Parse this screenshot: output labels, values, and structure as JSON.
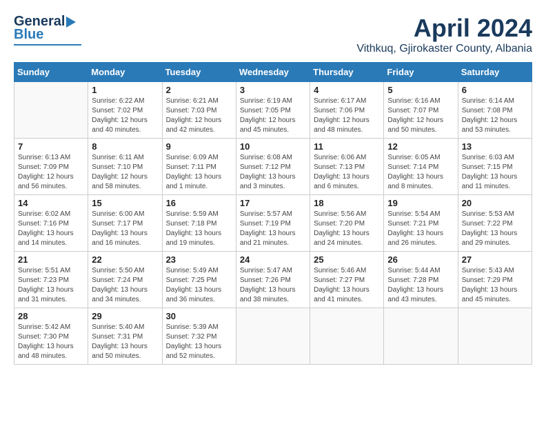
{
  "header": {
    "logo": {
      "line1": "General",
      "line2": "Blue"
    },
    "title": "April 2024",
    "subtitle": "Vithkuq, Gjirokaster County, Albania"
  },
  "weekdays": [
    "Sunday",
    "Monday",
    "Tuesday",
    "Wednesday",
    "Thursday",
    "Friday",
    "Saturday"
  ],
  "weeks": [
    [
      {
        "day": "",
        "sunrise": "",
        "sunset": "",
        "daylight": ""
      },
      {
        "day": "1",
        "sunrise": "Sunrise: 6:22 AM",
        "sunset": "Sunset: 7:02 PM",
        "daylight": "Daylight: 12 hours and 40 minutes."
      },
      {
        "day": "2",
        "sunrise": "Sunrise: 6:21 AM",
        "sunset": "Sunset: 7:03 PM",
        "daylight": "Daylight: 12 hours and 42 minutes."
      },
      {
        "day": "3",
        "sunrise": "Sunrise: 6:19 AM",
        "sunset": "Sunset: 7:05 PM",
        "daylight": "Daylight: 12 hours and 45 minutes."
      },
      {
        "day": "4",
        "sunrise": "Sunrise: 6:17 AM",
        "sunset": "Sunset: 7:06 PM",
        "daylight": "Daylight: 12 hours and 48 minutes."
      },
      {
        "day": "5",
        "sunrise": "Sunrise: 6:16 AM",
        "sunset": "Sunset: 7:07 PM",
        "daylight": "Daylight: 12 hours and 50 minutes."
      },
      {
        "day": "6",
        "sunrise": "Sunrise: 6:14 AM",
        "sunset": "Sunset: 7:08 PM",
        "daylight": "Daylight: 12 hours and 53 minutes."
      }
    ],
    [
      {
        "day": "7",
        "sunrise": "Sunrise: 6:13 AM",
        "sunset": "Sunset: 7:09 PM",
        "daylight": "Daylight: 12 hours and 56 minutes."
      },
      {
        "day": "8",
        "sunrise": "Sunrise: 6:11 AM",
        "sunset": "Sunset: 7:10 PM",
        "daylight": "Daylight: 12 hours and 58 minutes."
      },
      {
        "day": "9",
        "sunrise": "Sunrise: 6:09 AM",
        "sunset": "Sunset: 7:11 PM",
        "daylight": "Daylight: 13 hours and 1 minute."
      },
      {
        "day": "10",
        "sunrise": "Sunrise: 6:08 AM",
        "sunset": "Sunset: 7:12 PM",
        "daylight": "Daylight: 13 hours and 3 minutes."
      },
      {
        "day": "11",
        "sunrise": "Sunrise: 6:06 AM",
        "sunset": "Sunset: 7:13 PM",
        "daylight": "Daylight: 13 hours and 6 minutes."
      },
      {
        "day": "12",
        "sunrise": "Sunrise: 6:05 AM",
        "sunset": "Sunset: 7:14 PM",
        "daylight": "Daylight: 13 hours and 8 minutes."
      },
      {
        "day": "13",
        "sunrise": "Sunrise: 6:03 AM",
        "sunset": "Sunset: 7:15 PM",
        "daylight": "Daylight: 13 hours and 11 minutes."
      }
    ],
    [
      {
        "day": "14",
        "sunrise": "Sunrise: 6:02 AM",
        "sunset": "Sunset: 7:16 PM",
        "daylight": "Daylight: 13 hours and 14 minutes."
      },
      {
        "day": "15",
        "sunrise": "Sunrise: 6:00 AM",
        "sunset": "Sunset: 7:17 PM",
        "daylight": "Daylight: 13 hours and 16 minutes."
      },
      {
        "day": "16",
        "sunrise": "Sunrise: 5:59 AM",
        "sunset": "Sunset: 7:18 PM",
        "daylight": "Daylight: 13 hours and 19 minutes."
      },
      {
        "day": "17",
        "sunrise": "Sunrise: 5:57 AM",
        "sunset": "Sunset: 7:19 PM",
        "daylight": "Daylight: 13 hours and 21 minutes."
      },
      {
        "day": "18",
        "sunrise": "Sunrise: 5:56 AM",
        "sunset": "Sunset: 7:20 PM",
        "daylight": "Daylight: 13 hours and 24 minutes."
      },
      {
        "day": "19",
        "sunrise": "Sunrise: 5:54 AM",
        "sunset": "Sunset: 7:21 PM",
        "daylight": "Daylight: 13 hours and 26 minutes."
      },
      {
        "day": "20",
        "sunrise": "Sunrise: 5:53 AM",
        "sunset": "Sunset: 7:22 PM",
        "daylight": "Daylight: 13 hours and 29 minutes."
      }
    ],
    [
      {
        "day": "21",
        "sunrise": "Sunrise: 5:51 AM",
        "sunset": "Sunset: 7:23 PM",
        "daylight": "Daylight: 13 hours and 31 minutes."
      },
      {
        "day": "22",
        "sunrise": "Sunrise: 5:50 AM",
        "sunset": "Sunset: 7:24 PM",
        "daylight": "Daylight: 13 hours and 34 minutes."
      },
      {
        "day": "23",
        "sunrise": "Sunrise: 5:49 AM",
        "sunset": "Sunset: 7:25 PM",
        "daylight": "Daylight: 13 hours and 36 minutes."
      },
      {
        "day": "24",
        "sunrise": "Sunrise: 5:47 AM",
        "sunset": "Sunset: 7:26 PM",
        "daylight": "Daylight: 13 hours and 38 minutes."
      },
      {
        "day": "25",
        "sunrise": "Sunrise: 5:46 AM",
        "sunset": "Sunset: 7:27 PM",
        "daylight": "Daylight: 13 hours and 41 minutes."
      },
      {
        "day": "26",
        "sunrise": "Sunrise: 5:44 AM",
        "sunset": "Sunset: 7:28 PM",
        "daylight": "Daylight: 13 hours and 43 minutes."
      },
      {
        "day": "27",
        "sunrise": "Sunrise: 5:43 AM",
        "sunset": "Sunset: 7:29 PM",
        "daylight": "Daylight: 13 hours and 45 minutes."
      }
    ],
    [
      {
        "day": "28",
        "sunrise": "Sunrise: 5:42 AM",
        "sunset": "Sunset: 7:30 PM",
        "daylight": "Daylight: 13 hours and 48 minutes."
      },
      {
        "day": "29",
        "sunrise": "Sunrise: 5:40 AM",
        "sunset": "Sunset: 7:31 PM",
        "daylight": "Daylight: 13 hours and 50 minutes."
      },
      {
        "day": "30",
        "sunrise": "Sunrise: 5:39 AM",
        "sunset": "Sunset: 7:32 PM",
        "daylight": "Daylight: 13 hours and 52 minutes."
      },
      {
        "day": "",
        "sunrise": "",
        "sunset": "",
        "daylight": ""
      },
      {
        "day": "",
        "sunrise": "",
        "sunset": "",
        "daylight": ""
      },
      {
        "day": "",
        "sunrise": "",
        "sunset": "",
        "daylight": ""
      },
      {
        "day": "",
        "sunrise": "",
        "sunset": "",
        "daylight": ""
      }
    ]
  ]
}
